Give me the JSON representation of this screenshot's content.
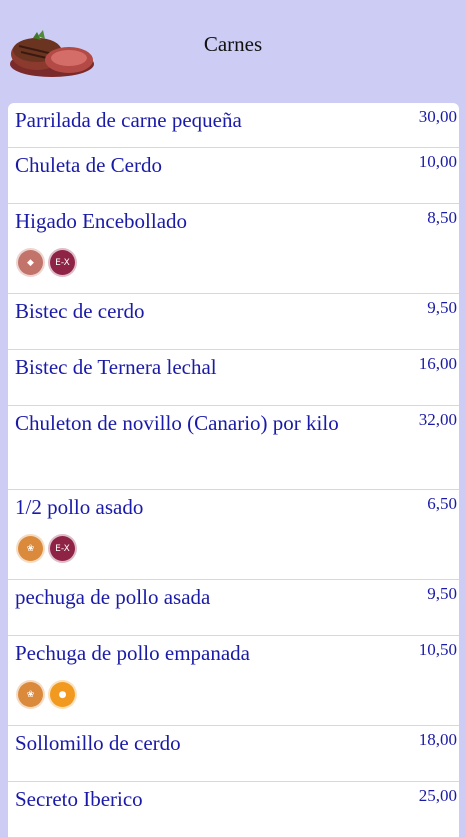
{
  "header": {
    "title": "Carnes",
    "image": "steak-image"
  },
  "items": [
    {
      "name": "Parrilada de carne pequeña",
      "price": "30,00",
      "allergens": []
    },
    {
      "name": "Chuleta de Cerdo",
      "price": "10,00",
      "allergens": []
    },
    {
      "name": "Higado Encebollado",
      "price": "8,50",
      "allergens": [
        "mollusc-icon",
        "sulfite-icon"
      ]
    },
    {
      "name": "Bistec de cerdo",
      "price": "9,50",
      "allergens": []
    },
    {
      "name": "Bistec de Ternera lechal",
      "price": "16,00",
      "allergens": []
    },
    {
      "name": "Chuleton de novillo (Canario) por kilo",
      "price": "32,00",
      "allergens": []
    },
    {
      "name": "1/2 pollo asado",
      "price": "6,50",
      "allergens": [
        "gluten-icon",
        "sulfite-icon"
      ]
    },
    {
      "name": "pechuga de pollo asada",
      "price": "9,50",
      "allergens": []
    },
    {
      "name": "Pechuga de pollo empanada",
      "price": "10,50",
      "allergens": [
        "gluten-icon",
        "egg-icon"
      ]
    },
    {
      "name": "Sollomillo de cerdo",
      "price": "18,00",
      "allergens": []
    },
    {
      "name": "Secreto Iberico",
      "price": "25,00",
      "allergens": []
    }
  ],
  "allergen_labels": {
    "sulfite": "E-X"
  },
  "colors": {
    "background": "#ccccf5",
    "text": "#1a1aa8"
  }
}
